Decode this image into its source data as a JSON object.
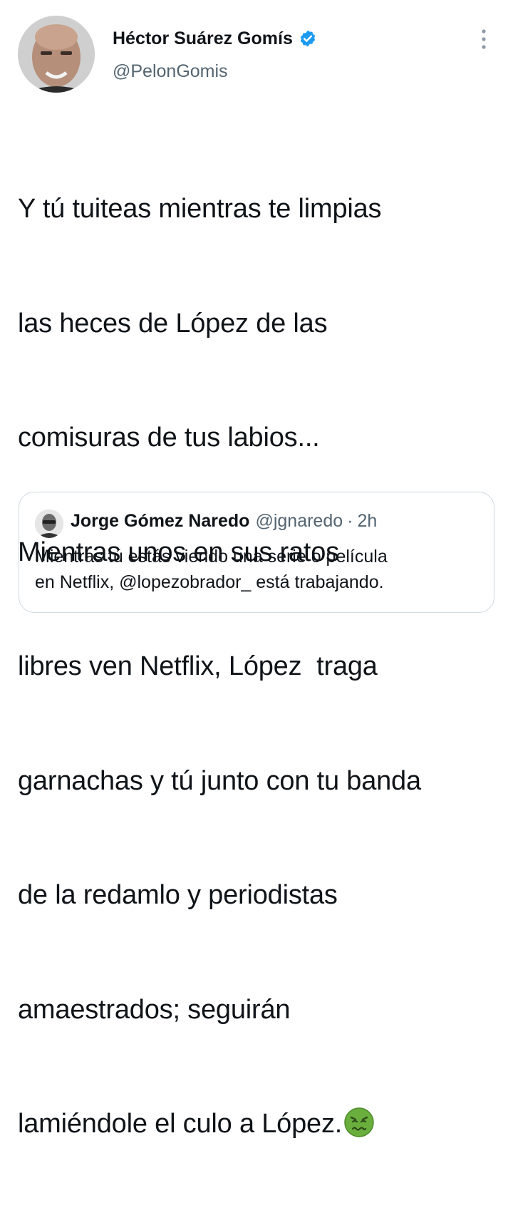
{
  "tweet": {
    "author": {
      "display_name": "Héctor Suárez Gomís",
      "handle": "@PelonGomis",
      "verified": true
    },
    "text_lines": [
      "Y tú tuiteas mientras te limpias",
      "las heces de López de las",
      "comisuras de tus labios...",
      "Mientras unos en sus ratos",
      "libres ven Netflix, López  traga",
      "garnachas y tú junto con tu banda",
      "de la redamlo y periodistas",
      "amaestrados; seguirán",
      "lamiéndole el culo a López."
    ],
    "emoji": "nauseated-face"
  },
  "quoted_tweet": {
    "author": {
      "display_name": "Jorge Gómez Naredo",
      "handle": "@jgnaredo",
      "separator": "·",
      "time": "2h"
    },
    "text_lines": [
      "Mientras tú estás viendo una serie o película",
      "en Netflix, @lopezobrador_ está trabajando."
    ]
  },
  "colors": {
    "verified_blue": "#1d9bf0",
    "secondary_text": "#536471",
    "border": "#cfd9de",
    "emoji_green": "#6aaf3d"
  }
}
